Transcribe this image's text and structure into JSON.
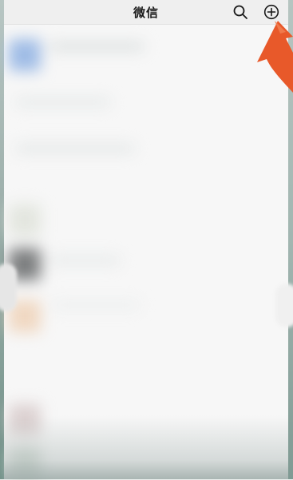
{
  "nav": {
    "title": "微信",
    "search_icon": "search-icon",
    "add_icon": "plus-circle-icon"
  },
  "annotation": {
    "arrow_color": "#e8592a"
  },
  "colors": {
    "background": "#f7f7f7",
    "nav_background": "#efefef"
  }
}
